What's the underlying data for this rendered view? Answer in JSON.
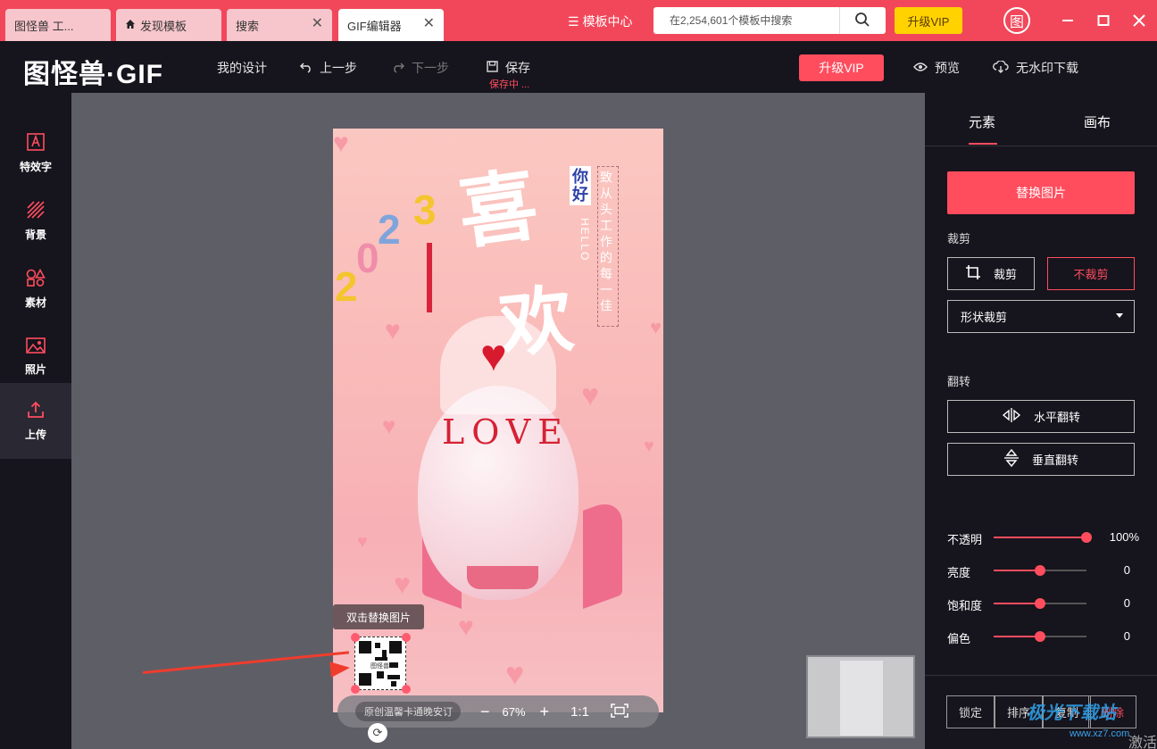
{
  "tabs": [
    {
      "label": "图怪兽 工..."
    },
    {
      "label": "发现模板"
    },
    {
      "label": "搜索"
    },
    {
      "label": "GIF编辑器"
    }
  ],
  "header": {
    "template_center": "模板中心",
    "search_placeholder": "在2,254,601个模板中搜索",
    "upgrade_vip": "升级VIP",
    "avatar_char": "图"
  },
  "toolbar": {
    "logo": "图怪兽·GIF",
    "my_design": "我的设计",
    "undo": "上一步",
    "redo": "下一步",
    "save": "保存",
    "saving_status": "保存中 ...",
    "vip": "升级VIP",
    "preview": "预览",
    "download": "无水印下载"
  },
  "sidebar": {
    "items": [
      {
        "label": "特效字",
        "icon": "text-effect-icon"
      },
      {
        "label": "背景",
        "icon": "background-icon"
      },
      {
        "label": "素材",
        "icon": "shapes-icon"
      },
      {
        "label": "照片",
        "icon": "photo-icon"
      },
      {
        "label": "上传",
        "icon": "upload-icon"
      }
    ]
  },
  "canvas": {
    "poster": {
      "year": [
        "2",
        "0",
        "2",
        "3"
      ],
      "xi": "喜",
      "huan": "欢",
      "nihao": "你好",
      "hello": "HELLO",
      "vertical_text": "致从头工作的每一佳",
      "love": "LOVE"
    },
    "tooltip": "双击替换图片",
    "qr_label": "图怪兽"
  },
  "zoombar": {
    "page_name": "原创温馨卡通晚安订",
    "zoom": "67%",
    "ratio": "1:1"
  },
  "panel": {
    "tab_elements": "元素",
    "tab_canvas": "画布",
    "replace_image": "替换图片",
    "crop_label": "裁剪",
    "crop_btn": "裁剪",
    "no_crop_btn": "不裁剪",
    "shape_crop": "形状裁剪",
    "flip_label": "翻转",
    "flip_h": "水平翻转",
    "flip_v": "垂直翻转",
    "sliders": [
      {
        "label": "不透明",
        "value": "100%",
        "level": 1.0
      },
      {
        "label": "亮度",
        "value": "0",
        "level": 0.5
      },
      {
        "label": "饱和度",
        "value": "0",
        "level": 0.5
      },
      {
        "label": "偏色",
        "value": "0",
        "level": 0.5
      }
    ],
    "bottom_buttons": [
      "锁定",
      "排序",
      "复制",
      "删除"
    ]
  },
  "overlay": {
    "watermark": "极光下载站",
    "watermark_url": "www.xz7.com",
    "activate": "激活"
  },
  "colors": {
    "brand_red": "#f2475a",
    "accent": "#ff4d5e",
    "dark_bg": "#16141d",
    "canvas_bg": "#5e5e67",
    "vip_yellow": "#ffd200"
  }
}
